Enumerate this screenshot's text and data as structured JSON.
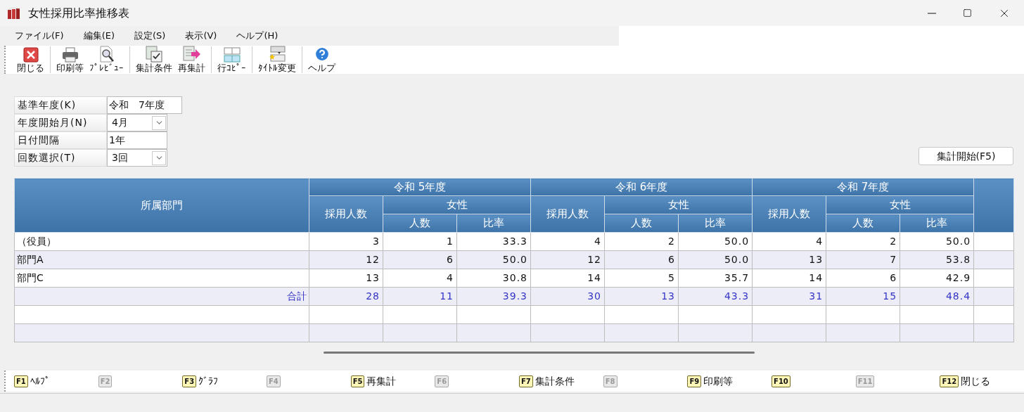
{
  "window": {
    "title": "女性採用比率推移表"
  },
  "menu": [
    "ファイル(F)",
    "編集(E)",
    "設定(S)",
    "表示(V)",
    "ヘルプ(H)"
  ],
  "toolbar": [
    "閉じる",
    "印刷等",
    "ﾌﾟﾚﾋﾞｭｰ",
    "集計条件",
    "再集計",
    "行ｺﾋﾟｰ",
    "ﾀｲﾄﾙ変更",
    "ヘルプ"
  ],
  "form": [
    {
      "label": "基準年度(K)",
      "kind": "text",
      "value": "令和　7年度"
    },
    {
      "label": "年度開始月(N)",
      "kind": "select",
      "value": "4月"
    },
    {
      "label": "日付間隔",
      "kind": "text",
      "value": "1年"
    },
    {
      "label": "回数選択(T)",
      "kind": "select",
      "value": "3回"
    }
  ],
  "start_button": "集計開始(F5)",
  "table": {
    "dept_header": "所属部門",
    "years": [
      {
        "title": "令和 5年度",
        "hired": "採用人数",
        "female": "女性",
        "count": "人数",
        "ratio": "比率"
      },
      {
        "title": "令和 6年度",
        "hired": "採用人数",
        "female": "女性",
        "count": "人数",
        "ratio": "比率"
      },
      {
        "title": "令和 7年度",
        "hired": "採用人数",
        "female": "女性",
        "count": "人数",
        "ratio": "比率"
      }
    ],
    "rows": [
      {
        "kind": "data",
        "dept": "（役員）",
        "values": [
          "3",
          "1",
          "33.3",
          "4",
          "2",
          "50.0",
          "4",
          "2",
          "50.0"
        ]
      },
      {
        "kind": "data",
        "dept": "部門A",
        "values": [
          "12",
          "6",
          "50.0",
          "12",
          "6",
          "50.0",
          "13",
          "7",
          "53.8"
        ]
      },
      {
        "kind": "data",
        "dept": "部門C",
        "values": [
          "13",
          "4",
          "30.8",
          "14",
          "5",
          "35.7",
          "14",
          "6",
          "42.9"
        ]
      },
      {
        "kind": "total",
        "dept": "合計",
        "values": [
          "28",
          "11",
          "39.3",
          "30",
          "13",
          "43.3",
          "31",
          "15",
          "48.4"
        ]
      },
      {
        "kind": "blank"
      },
      {
        "kind": "blank"
      }
    ]
  },
  "function_keys": [
    {
      "key": "F1",
      "label": "ﾍﾙﾌﾟ",
      "enabled": true
    },
    {
      "key": "F2",
      "enabled": false
    },
    {
      "key": "F3",
      "label": "ｸﾞﾗﾌ",
      "enabled": true
    },
    {
      "key": "F4",
      "enabled": false
    },
    {
      "key": "F5",
      "label": "再集計",
      "enabled": true
    },
    {
      "key": "F6",
      "enabled": false
    },
    {
      "key": "F7",
      "label": "集計条件",
      "enabled": true
    },
    {
      "key": "F8",
      "enabled": false
    },
    {
      "key": "F9",
      "label": "印刷等",
      "enabled": true
    },
    {
      "key": "F10",
      "enabled": true
    },
    {
      "key": "F11",
      "enabled": false
    },
    {
      "key": "F12",
      "label": "閉じる",
      "enabled": true
    }
  ]
}
